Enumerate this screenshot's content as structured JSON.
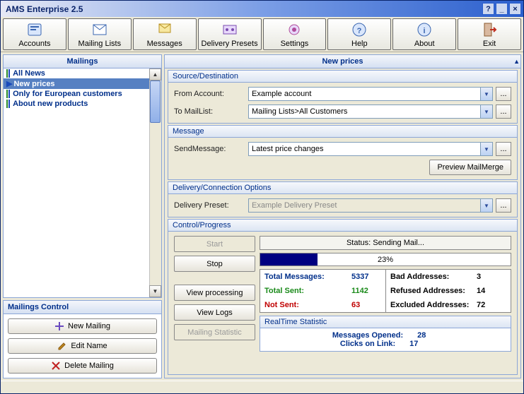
{
  "title": "AMS Enterprise 2.5",
  "toolbar": [
    {
      "label": "Accounts"
    },
    {
      "label": "Mailing Lists"
    },
    {
      "label": "Messages"
    },
    {
      "label": "Delivery Presets"
    },
    {
      "label": "Settings"
    },
    {
      "label": "Help"
    },
    {
      "label": "About"
    },
    {
      "label": "Exit"
    }
  ],
  "mailings_header": "Mailings",
  "mailings": [
    {
      "label": "All News"
    },
    {
      "label": "New prices",
      "selected": true
    },
    {
      "label": "Only for European customers"
    },
    {
      "label": "About new products"
    }
  ],
  "mc": {
    "header": "Mailings Control",
    "new": "New Mailing",
    "edit": "Edit Name",
    "del": "Delete Mailing"
  },
  "right_header": "New prices",
  "source": {
    "title": "Source/Destination",
    "from_label": "From Account:",
    "from_value": "Example account",
    "to_label": "To MailList:",
    "to_value": "Mailing Lists>All Customers"
  },
  "message": {
    "title": "Message",
    "send_label": "SendMessage:",
    "send_value": "Latest price changes",
    "preview": "Preview MailMerge"
  },
  "delivery": {
    "title": "Delivery/Connection Options",
    "preset_label": "Delivery Preset:",
    "preset_value": "Example Delivery Preset"
  },
  "control": {
    "title": "Control/Progress",
    "start": "Start",
    "stop": "Stop",
    "view_proc": "View processing",
    "view_logs": "View Logs",
    "mail_stat": "Mailing Statistic",
    "status": "Status: Sending Mail...",
    "progress": "23%",
    "stats": {
      "total_msg_l": "Total Messages:",
      "total_msg_v": "5337",
      "bad_l": "Bad Addresses:",
      "bad_v": "3",
      "sent_l": "Total Sent:",
      "sent_v": "1142",
      "ref_l": "Refused Addresses:",
      "ref_v": "14",
      "notsent_l": "Not Sent:",
      "notsent_v": "63",
      "excl_l": "Excluded Addresses:",
      "excl_v": "72"
    },
    "rt": {
      "title": "RealTime Statistic",
      "opened_l": "Messages Opened:",
      "opened_v": "28",
      "clicks_l": "Clicks on Link:",
      "clicks_v": "17"
    }
  },
  "dots": "..."
}
